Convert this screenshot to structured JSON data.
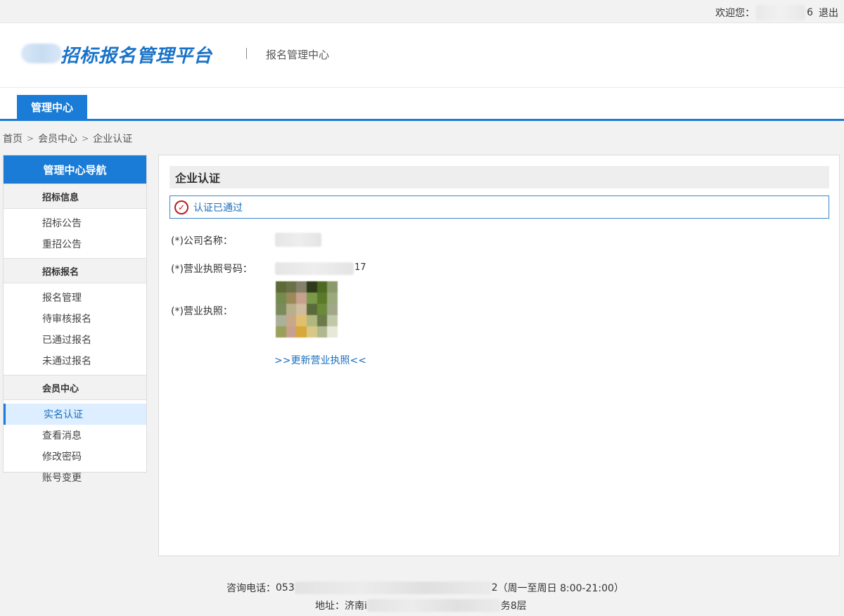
{
  "topbar": {
    "welcome_prefix": "欢迎您：",
    "welcome_suffix": "6",
    "logout": "退出"
  },
  "header": {
    "logo_text": "招标报名管理平台",
    "subtitle": "报名管理中心"
  },
  "nav": {
    "tab": "管理中心"
  },
  "breadcrumb": {
    "home": "首页",
    "sep": ">",
    "member": "会员中心",
    "current": "企业认证"
  },
  "sidebar": {
    "title": "管理中心导航",
    "sections": [
      {
        "head": "招标信息",
        "items": [
          "招标公告",
          "重招公告"
        ]
      },
      {
        "head": "招标报名",
        "items": [
          "报名管理",
          "待审核报名",
          "已通过报名",
          "未通过报名"
        ]
      },
      {
        "head": "会员中心",
        "items": [
          "实名认证",
          "查看消息",
          "修改密码",
          "账号变更"
        ]
      }
    ],
    "active_item": "实名认证"
  },
  "main": {
    "title": "企业认证",
    "notice": "认证已通过",
    "fields": {
      "company_label": "(*)公司名称：",
      "license_no_label": "(*)营业执照号码：",
      "license_no_tail": "17",
      "license_label": "(*)营业执照："
    },
    "update_link": ">>更新营业执照<<"
  },
  "footer": {
    "phone_label": "咨询电话：",
    "phone_head": "053",
    "phone_tail": "2",
    "hours": "（周一至周日 8:00-21:00）",
    "address_label": "地址：",
    "address_head": "济南i",
    "address_tail": "务8层"
  },
  "icons": {
    "notice": "check-circle-icon"
  },
  "colors": {
    "brand": "#1a7cd6",
    "link": "#1a6ebd",
    "check": "#c0181e"
  }
}
